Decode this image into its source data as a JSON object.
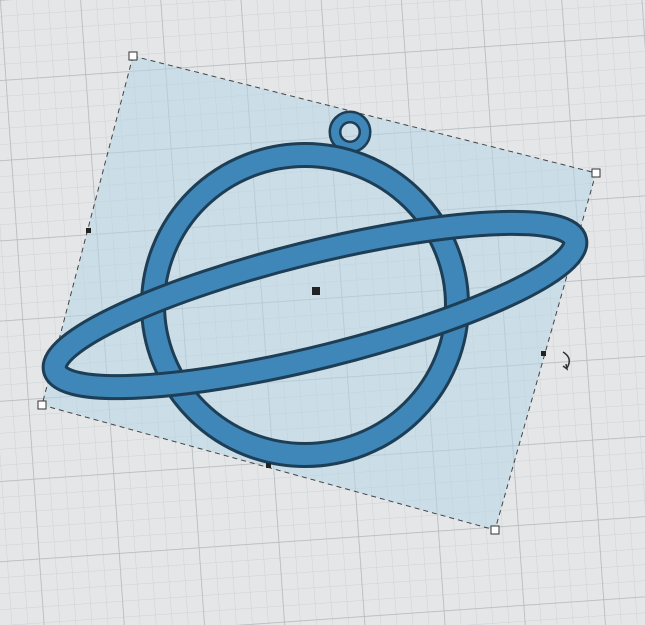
{
  "workplane": {
    "background": "#e4e6e8",
    "grid_minor": "#cfd3d6",
    "grid_major": "#b9bec2"
  },
  "selection": {
    "fill": "#bcd8e6",
    "outline": "#444444"
  },
  "model": {
    "name_icon": "planet-keychain",
    "color": "#3f86b9",
    "edge_color": "#1d3e55"
  },
  "icons": [
    "rotate-handle-icon",
    "center-handle-icon"
  ]
}
